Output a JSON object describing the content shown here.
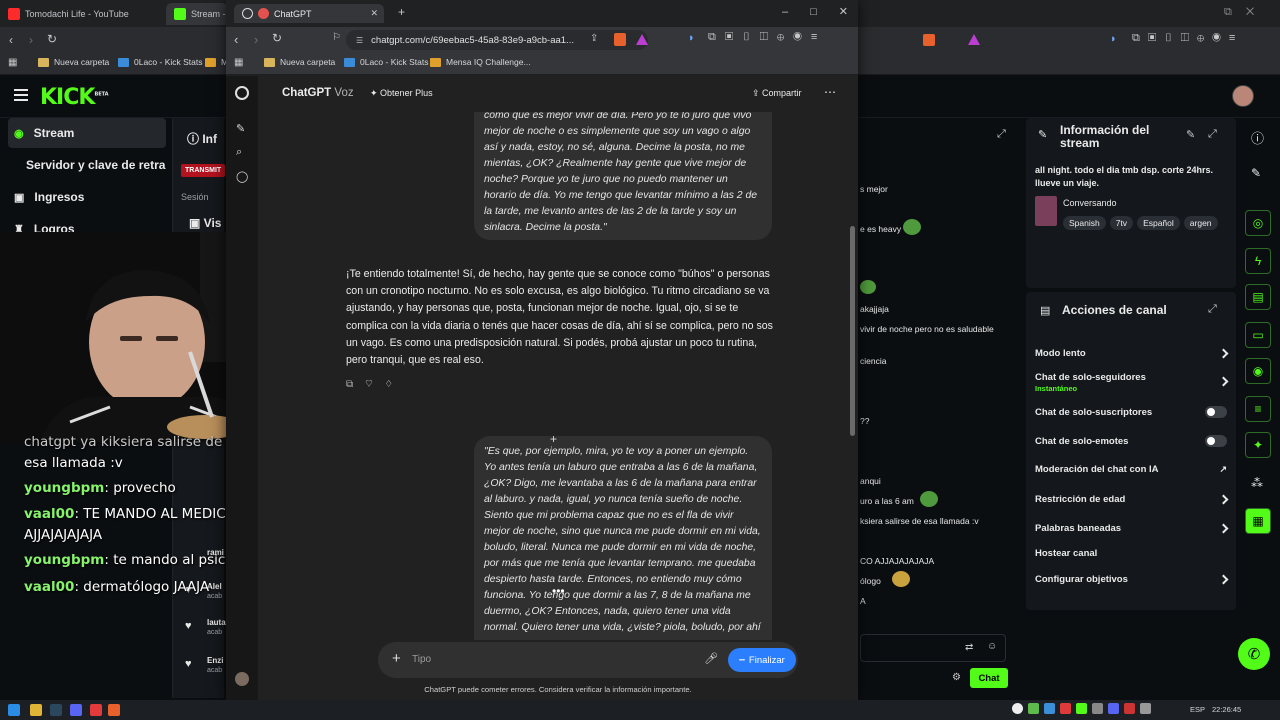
{
  "bg_browser": {
    "tabs": [
      {
        "label": "Tomodachi Life - YouTube",
        "favicon_color": "#ff2a2a"
      },
      {
        "label": "Stream - K",
        "favicon_color": "#53fc18"
      }
    ],
    "bookmarks": [
      "Nueva carpeta",
      "0Laco - Kick Stats",
      "M"
    ]
  },
  "kick": {
    "logo": "KICK",
    "logo_badge": "BETA",
    "nav": {
      "stream": "Stream",
      "stream_key": "Servidor y clave de retransmisión",
      "income": "Ingresos",
      "achievements": "Logros"
    },
    "mid_panel": {
      "title": "Inf",
      "badge": "TRANSMIT",
      "session": "Sesión",
      "views": "Vis",
      "followers": [
        {
          "name": "rami",
          "sub": ""
        },
        {
          "name": "Alel",
          "sub": "acab"
        },
        {
          "name": "lauta",
          "sub": "acab"
        },
        {
          "name": "Enzi",
          "sub": "acab"
        }
      ]
    },
    "chat_fragments": [
      "s mejor",
      "e es heavy",
      "akajjaja",
      "vivir de noche pero no es saludable",
      "ciencia",
      "??",
      "anqui",
      "uro a las 6 am",
      "ksiera salirse de esa llamada :v",
      "CO AJJAJAJAJAJA",
      "ólogo",
      "A"
    ],
    "chat_button": "Chat",
    "stream_info": {
      "title": "Información del stream",
      "description": "all night. todo el dia tmb dsp. corte 24hrs. llueve un viaje.",
      "category": "Conversando",
      "tags": [
        "Spanish",
        "7tv",
        "Español",
        "argen"
      ]
    },
    "channel_actions": {
      "title": "Acciones de canal",
      "items": [
        {
          "label": "Modo lento",
          "sub": "",
          "control": "chevron"
        },
        {
          "label": "Chat de solo-seguidores",
          "sub": "Instantáneo",
          "control": "chevron"
        },
        {
          "label": "Chat de solo-suscriptores",
          "sub": "",
          "control": "toggle"
        },
        {
          "label": "Chat de solo-emotes",
          "sub": "",
          "control": "toggle"
        },
        {
          "label": "Moderación del chat con IA",
          "sub": "",
          "control": "external"
        },
        {
          "label": "Restricción de edad",
          "sub": "",
          "control": "chevron"
        },
        {
          "label": "Palabras baneadas",
          "sub": "",
          "control": "chevron"
        },
        {
          "label": "Hostear canal",
          "sub": "",
          "control": "none"
        },
        {
          "label": "Configurar objetivos",
          "sub": "",
          "control": "chevron"
        }
      ]
    },
    "overlay_chat": [
      {
        "user": "",
        "text": "esa llamada :v"
      },
      {
        "user": "youngbpm",
        "text": ": provecho"
      },
      {
        "user": "vaal00",
        "text": ": TE MANDO AL MEDICO"
      },
      {
        "user": "",
        "text": "AJJAJAJAJAJA"
      },
      {
        "user": "youngbpm",
        "text": ": te mando al psicologo"
      },
      {
        "user": "vaal00",
        "text": ": dermatólogo JAAJA"
      }
    ],
    "overlay_partial": "chatgpt ya kiksiera salirse de"
  },
  "gpt_browser": {
    "tab_label": "ChatGPT",
    "url": "chatgpt.com/c/69eebac5-45a8-83e9-a9cb-aa1...",
    "bookmarks": [
      "Nueva carpeta",
      "0Laco - Kick Stats",
      "Mensa IQ Challenge..."
    ]
  },
  "chatgpt": {
    "model": "ChatGPT",
    "model_suffix": "Voz",
    "upgrade": "Obtener Plus",
    "share": "Compartir",
    "user_msg_1": "como que es mejor vivir de día. Pero yo te lo juro que vivo mejor de noche o es simplemente que soy un vago o algo así y nada, estoy, no sé, alguna. Decime la posta, no me mientas, ¿OK? ¿Realmente hay gente que vive mejor de noche? Porque yo te juro que no puedo mantener un horario de día. Yo me tengo que levantar mínimo a las 2 de la tarde, me levanto antes de las 2 de la tarde y soy un sinlacra. Decime la posta.\"",
    "assistant_msg": "¡Te entiendo totalmente! Sí, de hecho, hay gente que se conoce como \"búhos\" o personas con un cronotipo nocturno. No es solo excusa, es algo biológico. Tu ritmo circadiano se va ajustando, y hay personas que, posta, funcionan mejor de noche. Igual, ojo, si se te complica con la vida diaria o tenés que hacer cosas de día, ahí sí se complica, pero no sos un vago. Es como una predisposición natural. Si podés, probá ajustar un poco tu rutina, pero tranqui, que es real eso.",
    "user_msg_2": "\"Es que, por ejemplo, mira, yo te voy a poner un ejemplo. Yo antes tenía un laburo que entraba a las 6 de la mañana, ¿OK? Digo, me levantaba a las 6 de la mañana para entrar al laburo. y nada, igual, yo nunca tenía sueño de noche. Siento que mi problema capaz que no es el fla de vivir mejor de noche, sino que nunca me pude dormir en mi vida, boludo, literal. Nunca me pude dormir en mi vida de noche, por más que me tenía que levantar temprano. me quedaba despierto hasta tarde. Entonces, no entiendo muy cómo funciona. Yo tengo que dormir a las 7, 8 de la mañana me duermo, ¿OK? Entonces, nada, quiero tener una vida normal. Quiero tener una vida, ¿viste? piola, boludo, por ahí",
    "composer_placeholder": "Tipo",
    "finish": "Finalizar",
    "disclaimer": "ChatGPT puede cometer errores. Considera verificar la información importante."
  },
  "taskbar": {
    "lang": "ESP",
    "time": "22:26:45"
  },
  "colors": {
    "kick_green": "#53fc18",
    "gpt_bg": "#212121",
    "bubble": "#303030",
    "finish_blue": "#2b7fff"
  }
}
